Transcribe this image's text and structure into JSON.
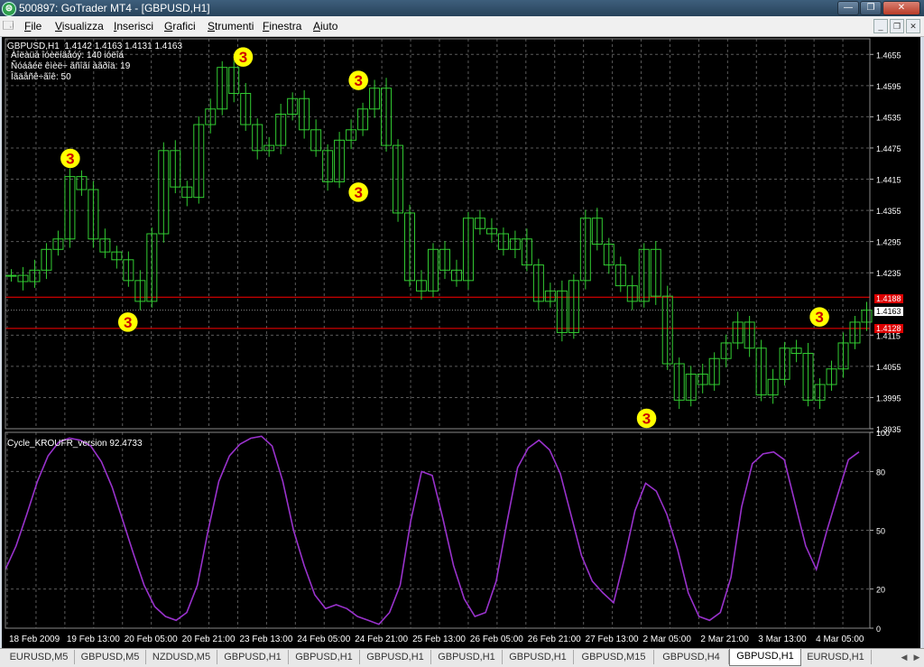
{
  "window": {
    "title": "500897: GoTrader MT4 - [GBPUSD,H1]",
    "icon": "app-logo-icon",
    "controls": [
      "minimize",
      "restore",
      "close"
    ]
  },
  "menu": {
    "items": [
      {
        "label": "File",
        "u": "F",
        "rest": "ile"
      },
      {
        "label": "Visualizza",
        "u": "V",
        "rest": "isualizza"
      },
      {
        "label": "Inserisci",
        "u": "I",
        "rest": "nserisci"
      },
      {
        "label": "Grafici",
        "u": "G",
        "rest": "rafici"
      },
      {
        "label": "Strumenti",
        "u": "S",
        "rest": "trumenti"
      },
      {
        "label": "Finestra",
        "u": "F",
        "rest": "inestra"
      },
      {
        "label": "Aiuto",
        "u": "A",
        "rest": "iuto"
      }
    ]
  },
  "chart": {
    "header": "GBPUSD,H1  1.4142 1.4163 1.4131 1.4163",
    "info_lines": [
      "Àîëàüá îóèëíäåóý: 140 ióëîá",
      "Ñóáâéë êìèë÷ ãñîãí àãðîä: 19",
      "Îãäåñê÷ãîê: 50"
    ],
    "bid_line_label": "1.4163",
    "upper_level_label": "1.4188",
    "lower_level_label": "1.4128",
    "indicator_title": "Cycle_KROUFR_version 92.4733",
    "colors": {
      "background": "#000000",
      "candles": "#32cd32",
      "grid": "#5a5a5a",
      "levels": "#ff0000",
      "indicator": "#9932cc",
      "marker_main": "#ffff00",
      "marker_orange": "#d2691e",
      "marker_pink": "#d01f7f"
    }
  },
  "chart_data": [
    {
      "type": "candlestick",
      "symbol": "GBPUSD",
      "timeframe": "H1",
      "ylim": [
        1.3935,
        1.4685
      ],
      "y_ticks": [
        "1.4655",
        "1.4595",
        "1.4535",
        "1.4475",
        "1.4415",
        "1.4355",
        "1.4295",
        "1.4235",
        "1.4115",
        "1.4055",
        "1.3995",
        "1.3935"
      ],
      "x_ticks": [
        "18 Feb 2009",
        "19 Feb 13:00",
        "20 Feb 05:00",
        "20 Feb 21:00",
        "23 Feb 13:00",
        "24 Feb 05:00",
        "24 Feb 21:00",
        "25 Feb 13:00",
        "26 Feb 05:00",
        "26 Feb 21:00",
        "27 Feb 13:00",
        "2 Mar 05:00",
        "2 Mar 21:00",
        "3 Mar 13:00",
        "4 Mar 05:00"
      ],
      "closes": [
        1.423,
        1.4218,
        1.424,
        1.428,
        1.43,
        1.442,
        1.4395,
        1.43,
        1.4275,
        1.426,
        1.422,
        1.418,
        1.431,
        1.447,
        1.44,
        1.438,
        1.452,
        1.455,
        1.463,
        1.458,
        1.452,
        1.447,
        1.448,
        1.454,
        1.457,
        1.451,
        1.447,
        1.441,
        1.449,
        1.451,
        1.455,
        1.459,
        1.448,
        1.435,
        1.422,
        1.42,
        1.428,
        1.424,
        1.422,
        1.434,
        1.432,
        1.431,
        1.428,
        1.43,
        1.425,
        1.418,
        1.42,
        1.412,
        1.422,
        1.434,
        1.429,
        1.425,
        1.421,
        1.418,
        1.428,
        1.419,
        1.406,
        1.399,
        1.404,
        1.402,
        1.407,
        1.41,
        1.414,
        1.409,
        1.4,
        1.403,
        1.409,
        1.408,
        1.399,
        1.402,
        1.405,
        1.41,
        1.414,
        1.4163
      ],
      "level_lines": [
        1.4188,
        1.4128
      ],
      "current_price": 1.4163,
      "markers": [
        {
          "label": "3",
          "kind": "main",
          "x": "19 Feb 13:00",
          "price": 1.4455
        },
        {
          "label": "3",
          "kind": "main",
          "x": "20 Feb 05:00",
          "price": 1.414
        },
        {
          "label": "3",
          "kind": "main",
          "x": "23 Feb 13:00",
          "price": 1.465
        },
        {
          "label": "3",
          "kind": "main",
          "x": "24 Feb 21:00",
          "price": 1.4605
        },
        {
          "label": "3",
          "kind": "main",
          "x": "24 Feb 21:00",
          "price": 1.439
        },
        {
          "label": "3",
          "kind": "main",
          "x": "2 Mar 05:00",
          "price": 1.3955
        },
        {
          "label": "3",
          "kind": "main",
          "x": "4 Mar 05:00",
          "price": 1.415
        }
      ]
    },
    {
      "type": "line",
      "title": "Cycle_KROUFR_version 92.4733",
      "ylim": [
        0,
        100
      ],
      "y_ticks": [
        100,
        80,
        50,
        20,
        0
      ],
      "values": [
        30,
        42,
        58,
        75,
        88,
        95,
        97,
        96,
        93,
        85,
        72,
        55,
        38,
        22,
        11,
        6,
        4,
        8,
        22,
        50,
        75,
        88,
        94,
        97,
        98,
        93,
        75,
        50,
        32,
        17,
        10,
        12,
        10,
        6,
        4,
        2,
        8,
        22,
        55,
        80,
        78,
        56,
        32,
        15,
        6,
        8,
        24,
        54,
        82,
        92,
        96,
        91,
        79,
        58,
        37,
        24,
        18,
        13,
        35,
        60,
        74,
        70,
        58,
        40,
        18,
        6,
        4,
        8,
        26,
        62,
        84,
        89,
        90,
        86,
        64,
        42,
        30,
        50,
        68,
        86,
        90
      ]
    }
  ]
}
